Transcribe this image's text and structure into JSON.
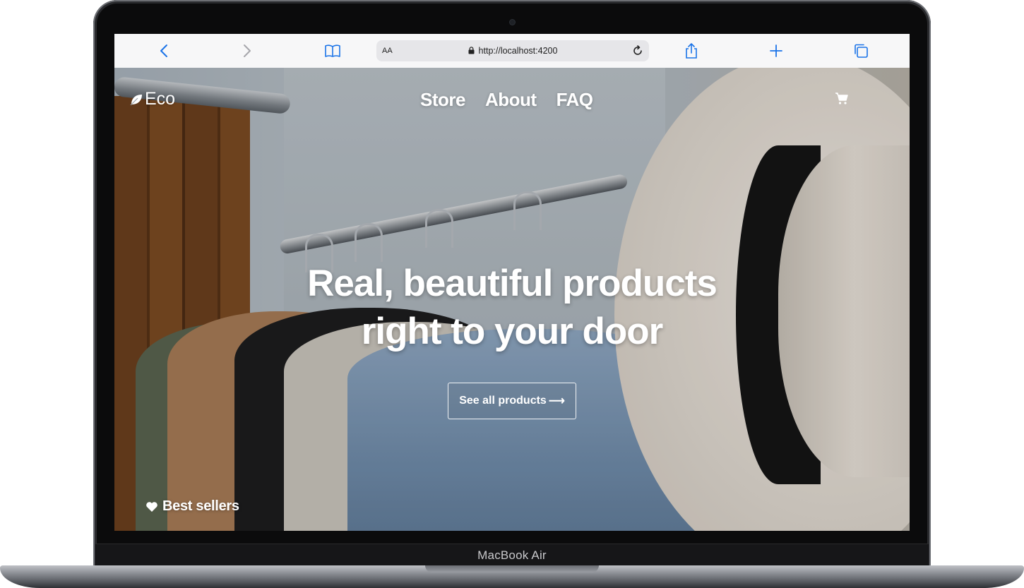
{
  "browser": {
    "text_size_label": "AA",
    "url": "http://localhost:4200",
    "icons": [
      "back-icon",
      "forward-icon",
      "bookmarks-icon",
      "lock-icon",
      "reload-icon",
      "share-icon",
      "new-tab-icon",
      "tabs-icon"
    ],
    "accent": "#1a73e8"
  },
  "site": {
    "logo": "Eco",
    "nav": [
      "Store",
      "About",
      "FAQ"
    ],
    "headline_line1": "Real, beautiful products",
    "headline_line2": "right to your door",
    "cta_label": "See all products",
    "cta_arrow": "⟶",
    "best_sellers": "Best sellers"
  },
  "device": {
    "label": "MacBook Air"
  }
}
